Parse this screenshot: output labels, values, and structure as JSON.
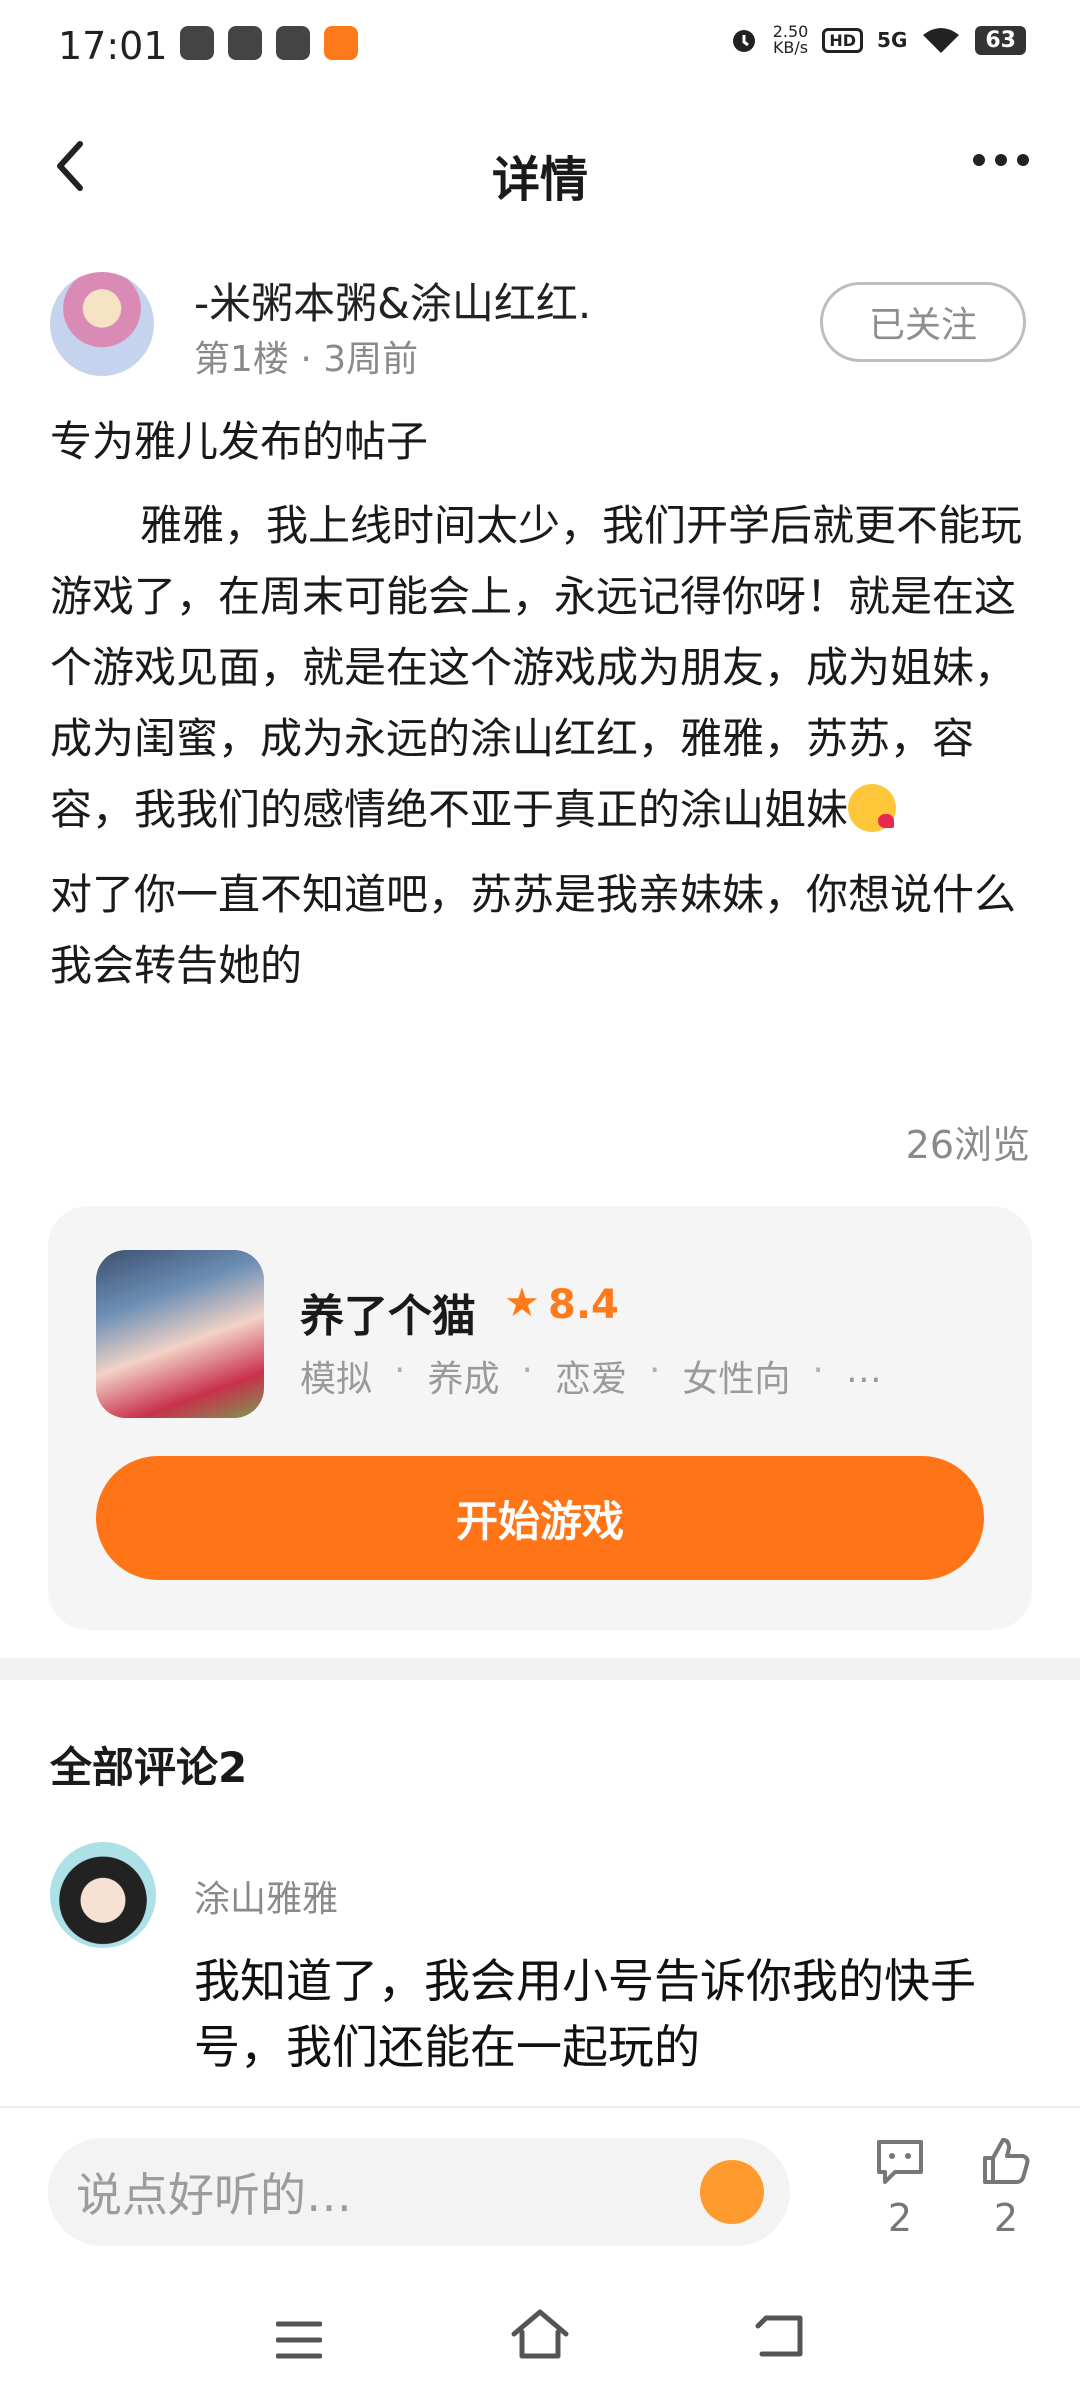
{
  "status_bar": {
    "time": "17:01",
    "net_speed": "2.50",
    "net_unit": "KB/s",
    "hd": "HD",
    "network": "5G",
    "battery": "63"
  },
  "header": {
    "title": "详情"
  },
  "author": {
    "name": "-米粥本粥&涂山红红.",
    "meta": "第1楼 · 3周前",
    "follow_label": "已关注"
  },
  "post": {
    "title": "专为雅儿发布的帖子",
    "paragraph_1": "雅雅，我上线时间太少，我们开学后就更不能玩游戏了，在周末可能会上，永远记得你呀！就是在这个游戏见面，就是在这个游戏成为朋友，成为姐妹，成为闺蜜，成为永远的涂山红红，雅雅，苏苏，容容，我我们的感情绝不亚于真正的涂山姐妹",
    "paragraph_2": "对了你一直不知道吧，苏苏是我亲妹妹，你想说什么我会转告她的",
    "views": "26浏览"
  },
  "game": {
    "name": "养了个猫",
    "rating": "8.4",
    "tags": [
      "模拟",
      "养成",
      "恋爱",
      "女性向",
      "…"
    ],
    "play_label": "开始游戏"
  },
  "comments": {
    "title": "全部评论2",
    "items": [
      {
        "user": "涂山雅雅",
        "text": "我知道了，我会用小号告诉你我的快手号，我们还能在一起玩的"
      }
    ]
  },
  "bottom_bar": {
    "input_placeholder": "说点好听的…",
    "comment_count": "2",
    "like_count": "2"
  },
  "colors": {
    "accent": "#ff7416",
    "rating": "#ff7a1a"
  }
}
